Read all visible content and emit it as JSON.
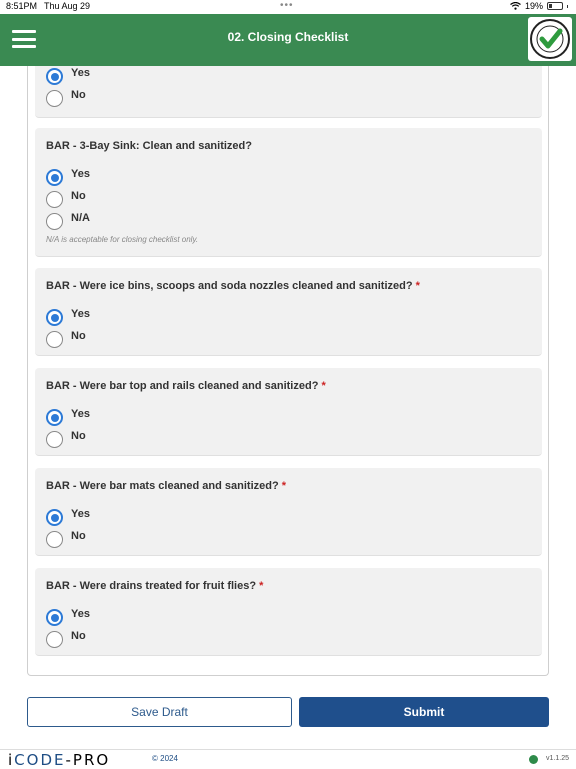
{
  "status_bar": {
    "time": "8:51PM",
    "date": "Thu Aug 29",
    "battery": "19%"
  },
  "header": {
    "title": "02. Closing Checklist",
    "menu_icon": "hamburger-icon",
    "badge": "QUALITY CONTROL APPROVED"
  },
  "form": {
    "partial": {
      "options": [
        "Yes",
        "No"
      ],
      "selected": "Yes"
    },
    "questions": [
      {
        "text": "BAR - 3-Bay Sink: Clean and sanitized?",
        "required": false,
        "options": [
          "Yes",
          "No",
          "N/A"
        ],
        "selected": "Yes",
        "hint": "N/A is acceptable for closing checklist only."
      },
      {
        "text": "BAR - Were ice bins, scoops and soda nozzles cleaned and sanitized?",
        "required": true,
        "options": [
          "Yes",
          "No"
        ],
        "selected": "Yes"
      },
      {
        "text": "BAR - Were bar top and rails cleaned and sanitized?",
        "required": true,
        "options": [
          "Yes",
          "No"
        ],
        "selected": "Yes"
      },
      {
        "text": "BAR - Were bar mats cleaned and sanitized?",
        "required": true,
        "options": [
          "Yes",
          "No"
        ],
        "selected": "Yes"
      },
      {
        "text": "BAR - Were drains treated for fruit flies?",
        "required": true,
        "options": [
          "Yes",
          "No"
        ],
        "selected": "Yes"
      }
    ],
    "required_marker": "*"
  },
  "actions": {
    "save_draft": "Save Draft",
    "submit": "Submit"
  },
  "footer": {
    "logo_i": "i",
    "logo_code": "CODE",
    "logo_pro": "-PRO",
    "copyright": "© 2024",
    "version": "v1.1.25",
    "status_color": "#2e8b4a"
  },
  "colors": {
    "header": "#3a8a52",
    "accent": "#2d7ad6",
    "submit": "#1f4f8c"
  }
}
